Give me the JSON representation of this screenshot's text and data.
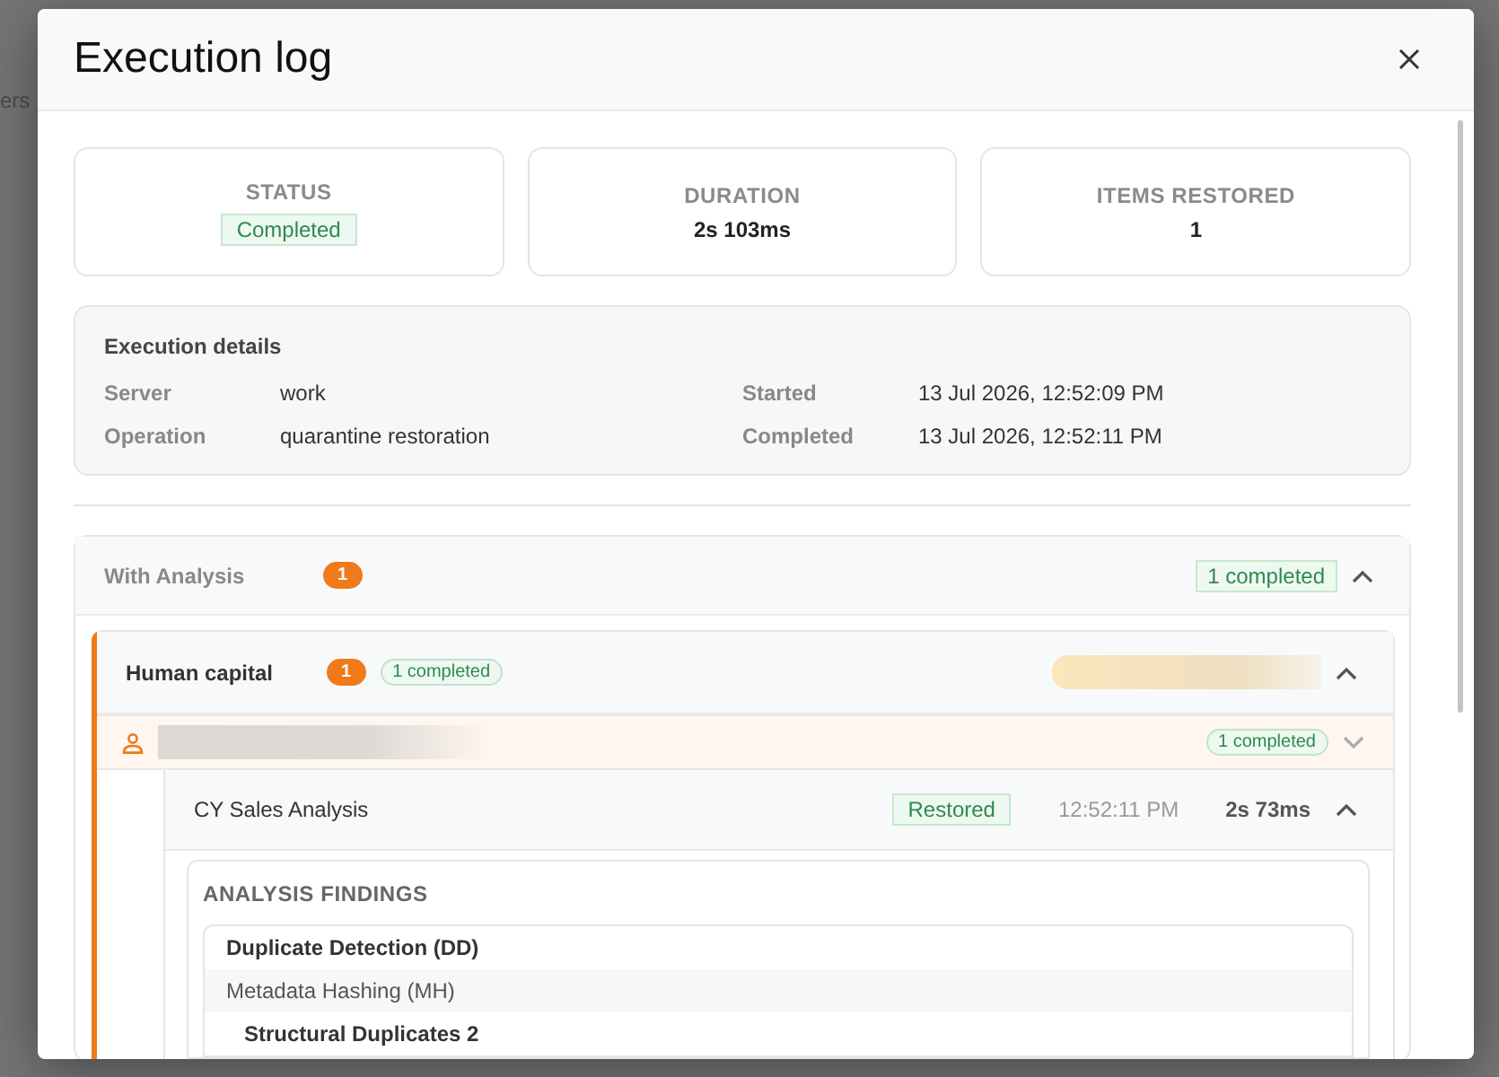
{
  "background": {
    "partial_label": "ers"
  },
  "dialog": {
    "title": "Execution log"
  },
  "stats": [
    {
      "label": "STATUS",
      "value": "Completed",
      "kind": "badge"
    },
    {
      "label": "DURATION",
      "value": "2s 103ms",
      "kind": "text"
    },
    {
      "label": "ITEMS RESTORED",
      "value": "1",
      "kind": "text"
    }
  ],
  "execution_details": {
    "title": "Execution details",
    "fields": [
      {
        "label": "Server",
        "value": "work"
      },
      {
        "label": "Started",
        "value": "13 Jul 2026, 12:52:09 PM"
      },
      {
        "label": "Operation",
        "value": "quarantine restoration"
      },
      {
        "label": "Completed",
        "value": "13 Jul 2026, 12:52:11 PM"
      }
    ]
  },
  "group": {
    "title": "With Analysis",
    "count": "1",
    "summary": "1 completed",
    "expanded": true,
    "category": {
      "title": "Human capital",
      "count": "1",
      "summary": "1 completed",
      "expanded": true,
      "user": {
        "summary": "1 completed",
        "expanded": false,
        "item": {
          "name": "CY Sales Analysis",
          "status": "Restored",
          "time": "12:52:11 PM",
          "duration": "2s 73ms",
          "expanded": true,
          "findings": {
            "title": "ANALYSIS FINDINGS",
            "rows": [
              {
                "text": "Duplicate Detection (DD)",
                "kind": "heading"
              },
              {
                "text": "Metadata Hashing (MH)",
                "kind": "method"
              },
              {
                "text": "Structural Duplicates 2",
                "kind": "result"
              }
            ]
          }
        }
      }
    }
  }
}
